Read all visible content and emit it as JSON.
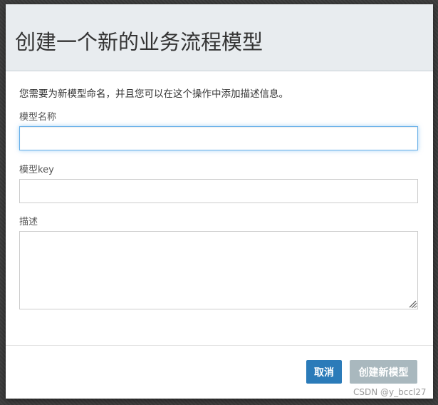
{
  "dialog": {
    "title": "创建一个新的业务流程模型",
    "intro": "您需要为新模型命名，并且您可以在这个操作中添加描述信息。"
  },
  "form": {
    "name_label": "模型名称",
    "name_value": "",
    "key_label": "模型key",
    "key_value": "",
    "description_label": "描述",
    "description_value": ""
  },
  "buttons": {
    "cancel_label": "取消",
    "create_label": "创建新模型"
  },
  "watermark": "CSDN @y_bccl27",
  "colors": {
    "header_bg": "#e8ecef",
    "cancel_bg": "#2b7bb9",
    "create_bg_disabled": "#a9b8be",
    "focus_ring": "#66afe9"
  }
}
